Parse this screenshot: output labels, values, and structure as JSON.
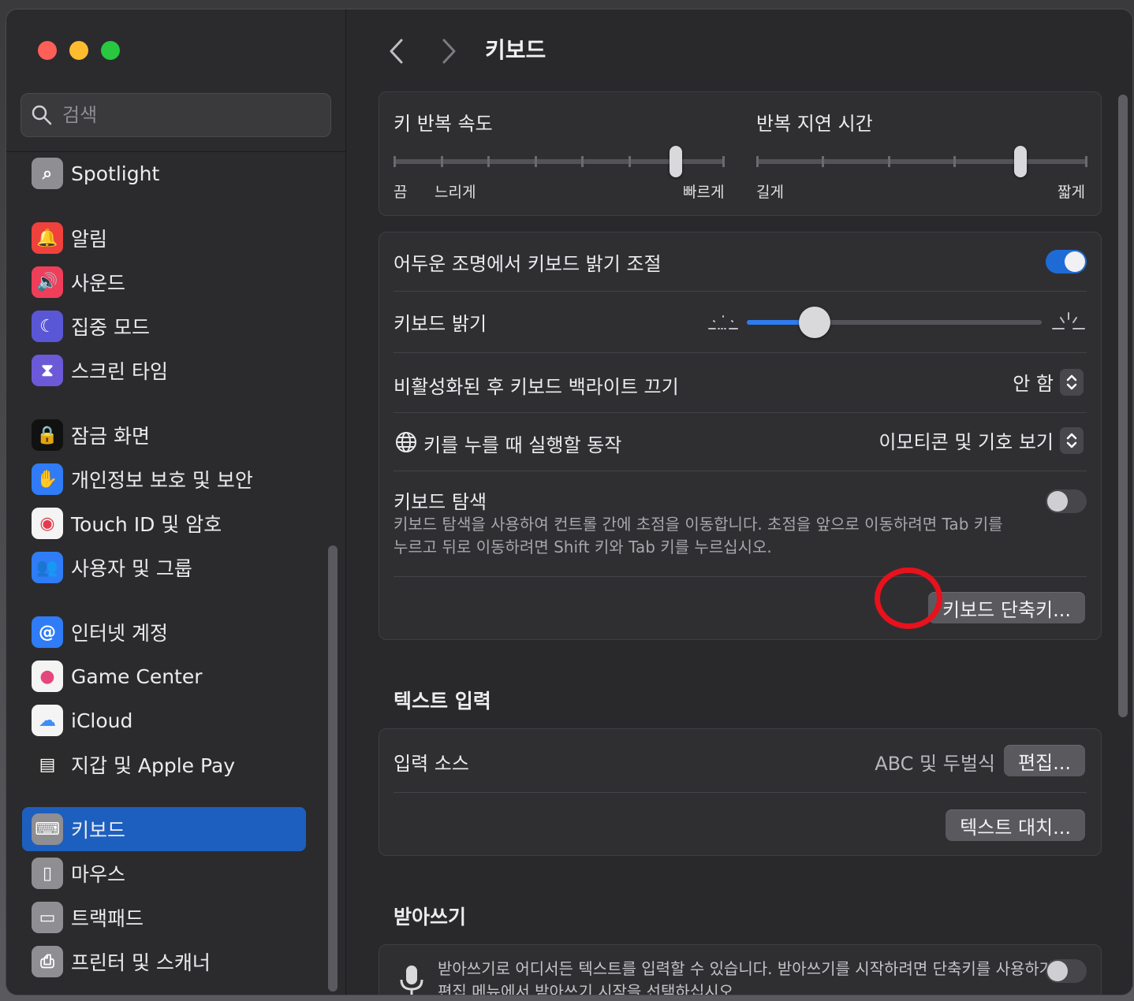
{
  "search": {
    "placeholder": "검색"
  },
  "sidebar": {
    "items": [
      {
        "label": "Spotlight",
        "icon": "spotlight-icon",
        "color": "#8e8e93"
      },
      {
        "label": "알림",
        "icon": "bell-icon",
        "color": "#f0413d"
      },
      {
        "label": "사운드",
        "icon": "speaker-icon",
        "color": "#ef3e5a"
      },
      {
        "label": "집중 모드",
        "icon": "moon-icon",
        "color": "#5a57d6"
      },
      {
        "label": "스크린 타임",
        "icon": "hourglass-icon",
        "color": "#6b5ad8"
      },
      {
        "label": "잠금 화면",
        "icon": "lock-icon",
        "color": "#111111"
      },
      {
        "label": "개인정보 보호 및 보안",
        "icon": "hand-icon",
        "color": "#2f7cf6"
      },
      {
        "label": "Touch ID 및 암호",
        "icon": "fingerprint-icon",
        "color": "#f4f4f4"
      },
      {
        "label": "사용자 및 그룹",
        "icon": "users-icon",
        "color": "#2f7cf6"
      },
      {
        "label": "인터넷 계정",
        "icon": "at-icon",
        "color": "#2f7cf6"
      },
      {
        "label": "Game Center",
        "icon": "game-center-icon",
        "color": "#f4f4f4"
      },
      {
        "label": "iCloud",
        "icon": "cloud-icon",
        "color": "#f4f4f4"
      },
      {
        "label": "지갑 및 Apple Pay",
        "icon": "wallet-icon",
        "color": "#2b2b2b"
      },
      {
        "label": "키보드",
        "icon": "keyboard-icon",
        "color": "#8e8e93"
      },
      {
        "label": "마우스",
        "icon": "mouse-icon",
        "color": "#8e8e93"
      },
      {
        "label": "트랙패드",
        "icon": "trackpad-icon",
        "color": "#8e8e93"
      },
      {
        "label": "프린터 및 스캐너",
        "icon": "printer-icon",
        "color": "#8e8e93"
      }
    ],
    "selected_label": "키보드",
    "accent": "#1d5fbf"
  },
  "main": {
    "title": "키보드",
    "key_repeat": {
      "label": "키 반복 속도",
      "min_labels": [
        "끔",
        "느리게"
      ],
      "max_label": "빠르게",
      "level": 6,
      "stops": 8
    },
    "repeat_delay": {
      "label": "반복 지연 시간",
      "min_label": "길게",
      "max_label": "짧게",
      "level": 4,
      "stops": 6
    },
    "backlight": {
      "auto_label": "어두운 조명에서 키보드 밝기 조절",
      "auto_on": true,
      "brightness_label": "키보드 밝기",
      "brightness_level": 0.23,
      "off_after_label": "비활성화된 후 키보드 백라이트 끄기",
      "off_after_value": "안 함",
      "globe_label": "키를 누를 때 실행할 동작",
      "globe_value": "이모티콘 및 기호 보기",
      "nav_label": "키보드 탐색",
      "nav_desc_1": "키보드 탐색을 사용하여 컨트롤 간에 초점을 이동합니다. 초점을 앞으로 이동하려면 Tab 키를",
      "nav_desc_2": "누르고 뒤로 이동하려면 Shift 키와 Tab 키를 누르십시오.",
      "nav_on": false,
      "shortcuts_button": "키보드 단축키..."
    },
    "text_input": {
      "section": "텍스트 입력",
      "source_label": "입력 소스",
      "source_value": "ABC 및 두벌식",
      "edit_button": "편집...",
      "replace_button": "텍스트 대치..."
    },
    "dictation": {
      "section": "받아쓰기",
      "desc_1": "받아쓰기로 어디서든 텍스트를 입력할 수 있습니다. 받아쓰기를 시작하려면 단축키를 사용하거나",
      "desc_2": "편집 메뉴에서 받아쓰기 시작을 선택하십시오.",
      "on": false
    }
  },
  "annotation_color": "#e8111c"
}
